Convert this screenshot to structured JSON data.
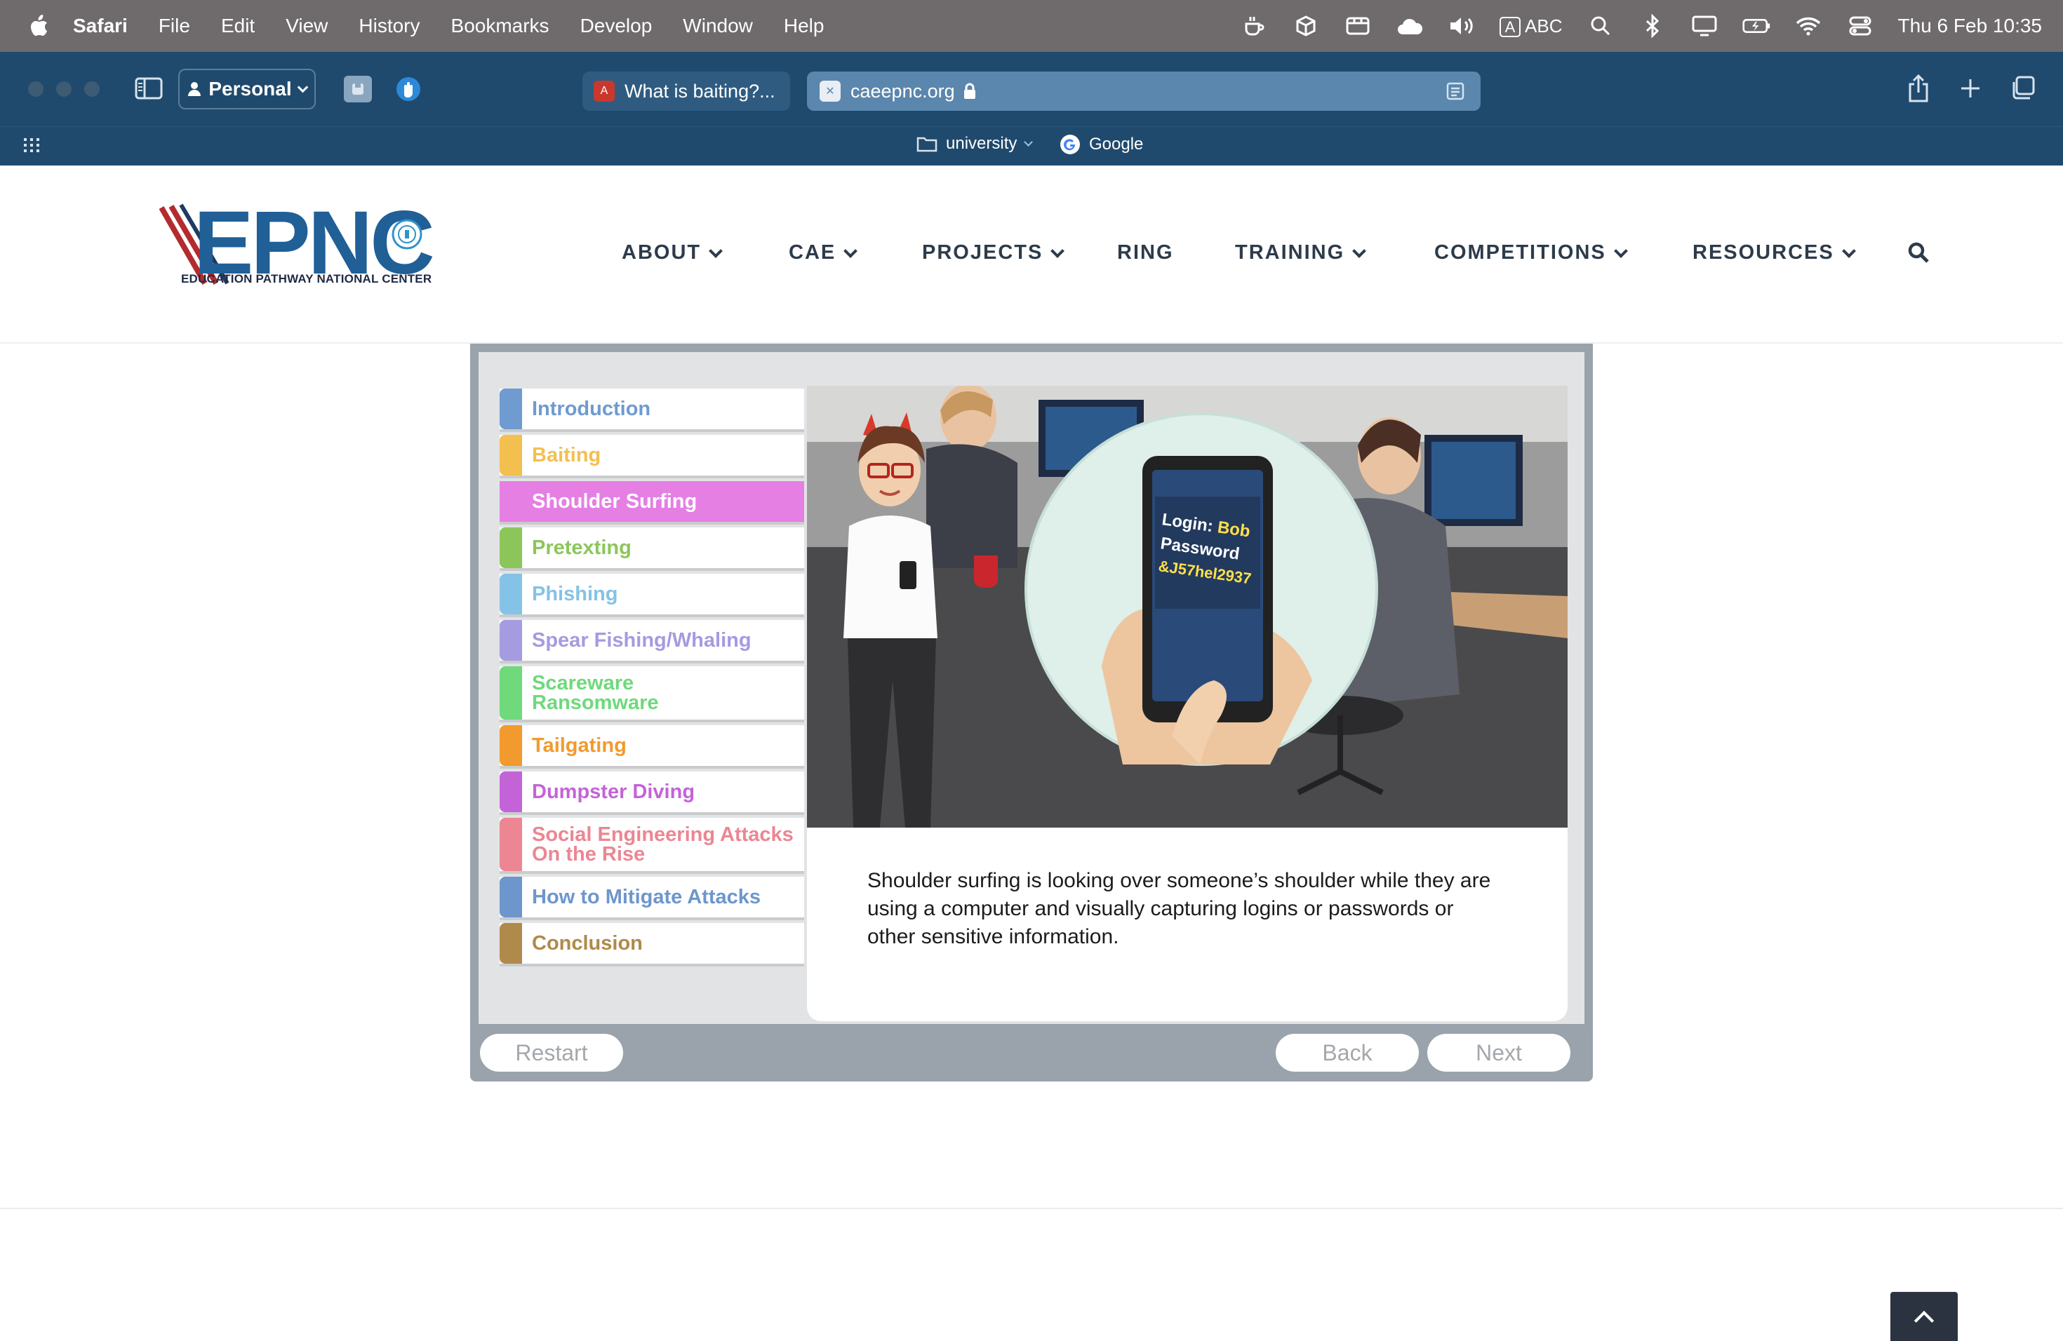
{
  "menubar": {
    "app_name": "Safari",
    "items": [
      "File",
      "Edit",
      "View",
      "History",
      "Bookmarks",
      "Develop",
      "Window",
      "Help"
    ],
    "input_source": "ABC",
    "input_badge": "A",
    "clock": "Thu 6 Feb  10:35"
  },
  "toolbar": {
    "profile_label": "Personal",
    "tabs": [
      {
        "title": "What is baiting?...",
        "active": false
      },
      {
        "title": "caeepnc.org",
        "active": true
      }
    ]
  },
  "favorites": {
    "folder": "university",
    "link": "Google"
  },
  "site": {
    "logo_text": "EPNC",
    "logo_subtitle": "EDUCATION PATHWAY NATIONAL CENTER",
    "nav": [
      {
        "label": "ABOUT",
        "dropdown": true
      },
      {
        "label": "CAE",
        "dropdown": true
      },
      {
        "label": "PROJECTS",
        "dropdown": true
      },
      {
        "label": "RING",
        "dropdown": false
      },
      {
        "label": "TRAINING",
        "dropdown": true
      },
      {
        "label": "COMPETITIONS",
        "dropdown": true
      },
      {
        "label": "RESOURCES",
        "dropdown": true
      }
    ]
  },
  "module": {
    "menu": [
      {
        "label": "Introduction",
        "color": "#6f9bd0"
      },
      {
        "label": "Baiting",
        "color": "#f3bf4f"
      },
      {
        "label": "Shoulder Surfing",
        "color": "#e57fe4",
        "selected": true
      },
      {
        "label": "Pretexting",
        "color": "#8cc65b"
      },
      {
        "label": "Phishing",
        "color": "#85c2e7"
      },
      {
        "label": "Spear Fishing/Whaling",
        "color": "#a59be0"
      },
      {
        "label": "Scareware\nRansomware",
        "color": "#6fd97c"
      },
      {
        "label": "Tailgating",
        "color": "#f29a2e"
      },
      {
        "label": "Dumpster Diving",
        "color": "#c463d8"
      },
      {
        "label": "Social Engineering Attacks\nOn the Rise",
        "color": "#ec8693"
      },
      {
        "label": "How to Mitigate Attacks",
        "color": "#6d96cc"
      },
      {
        "label": "Conclusion",
        "color": "#b08a4a"
      }
    ],
    "illustration_text": {
      "login_label": "Login:",
      "login_value": "Bob",
      "password_label": "Password",
      "password_value": "&J57hel2937"
    },
    "body_text": "Shoulder surfing is looking over someone’s shoulder while they are using a computer and visually capturing logins or passwords or other sensitive information.",
    "buttons": {
      "restart": "Restart",
      "back": "Back",
      "next": "Next"
    }
  }
}
